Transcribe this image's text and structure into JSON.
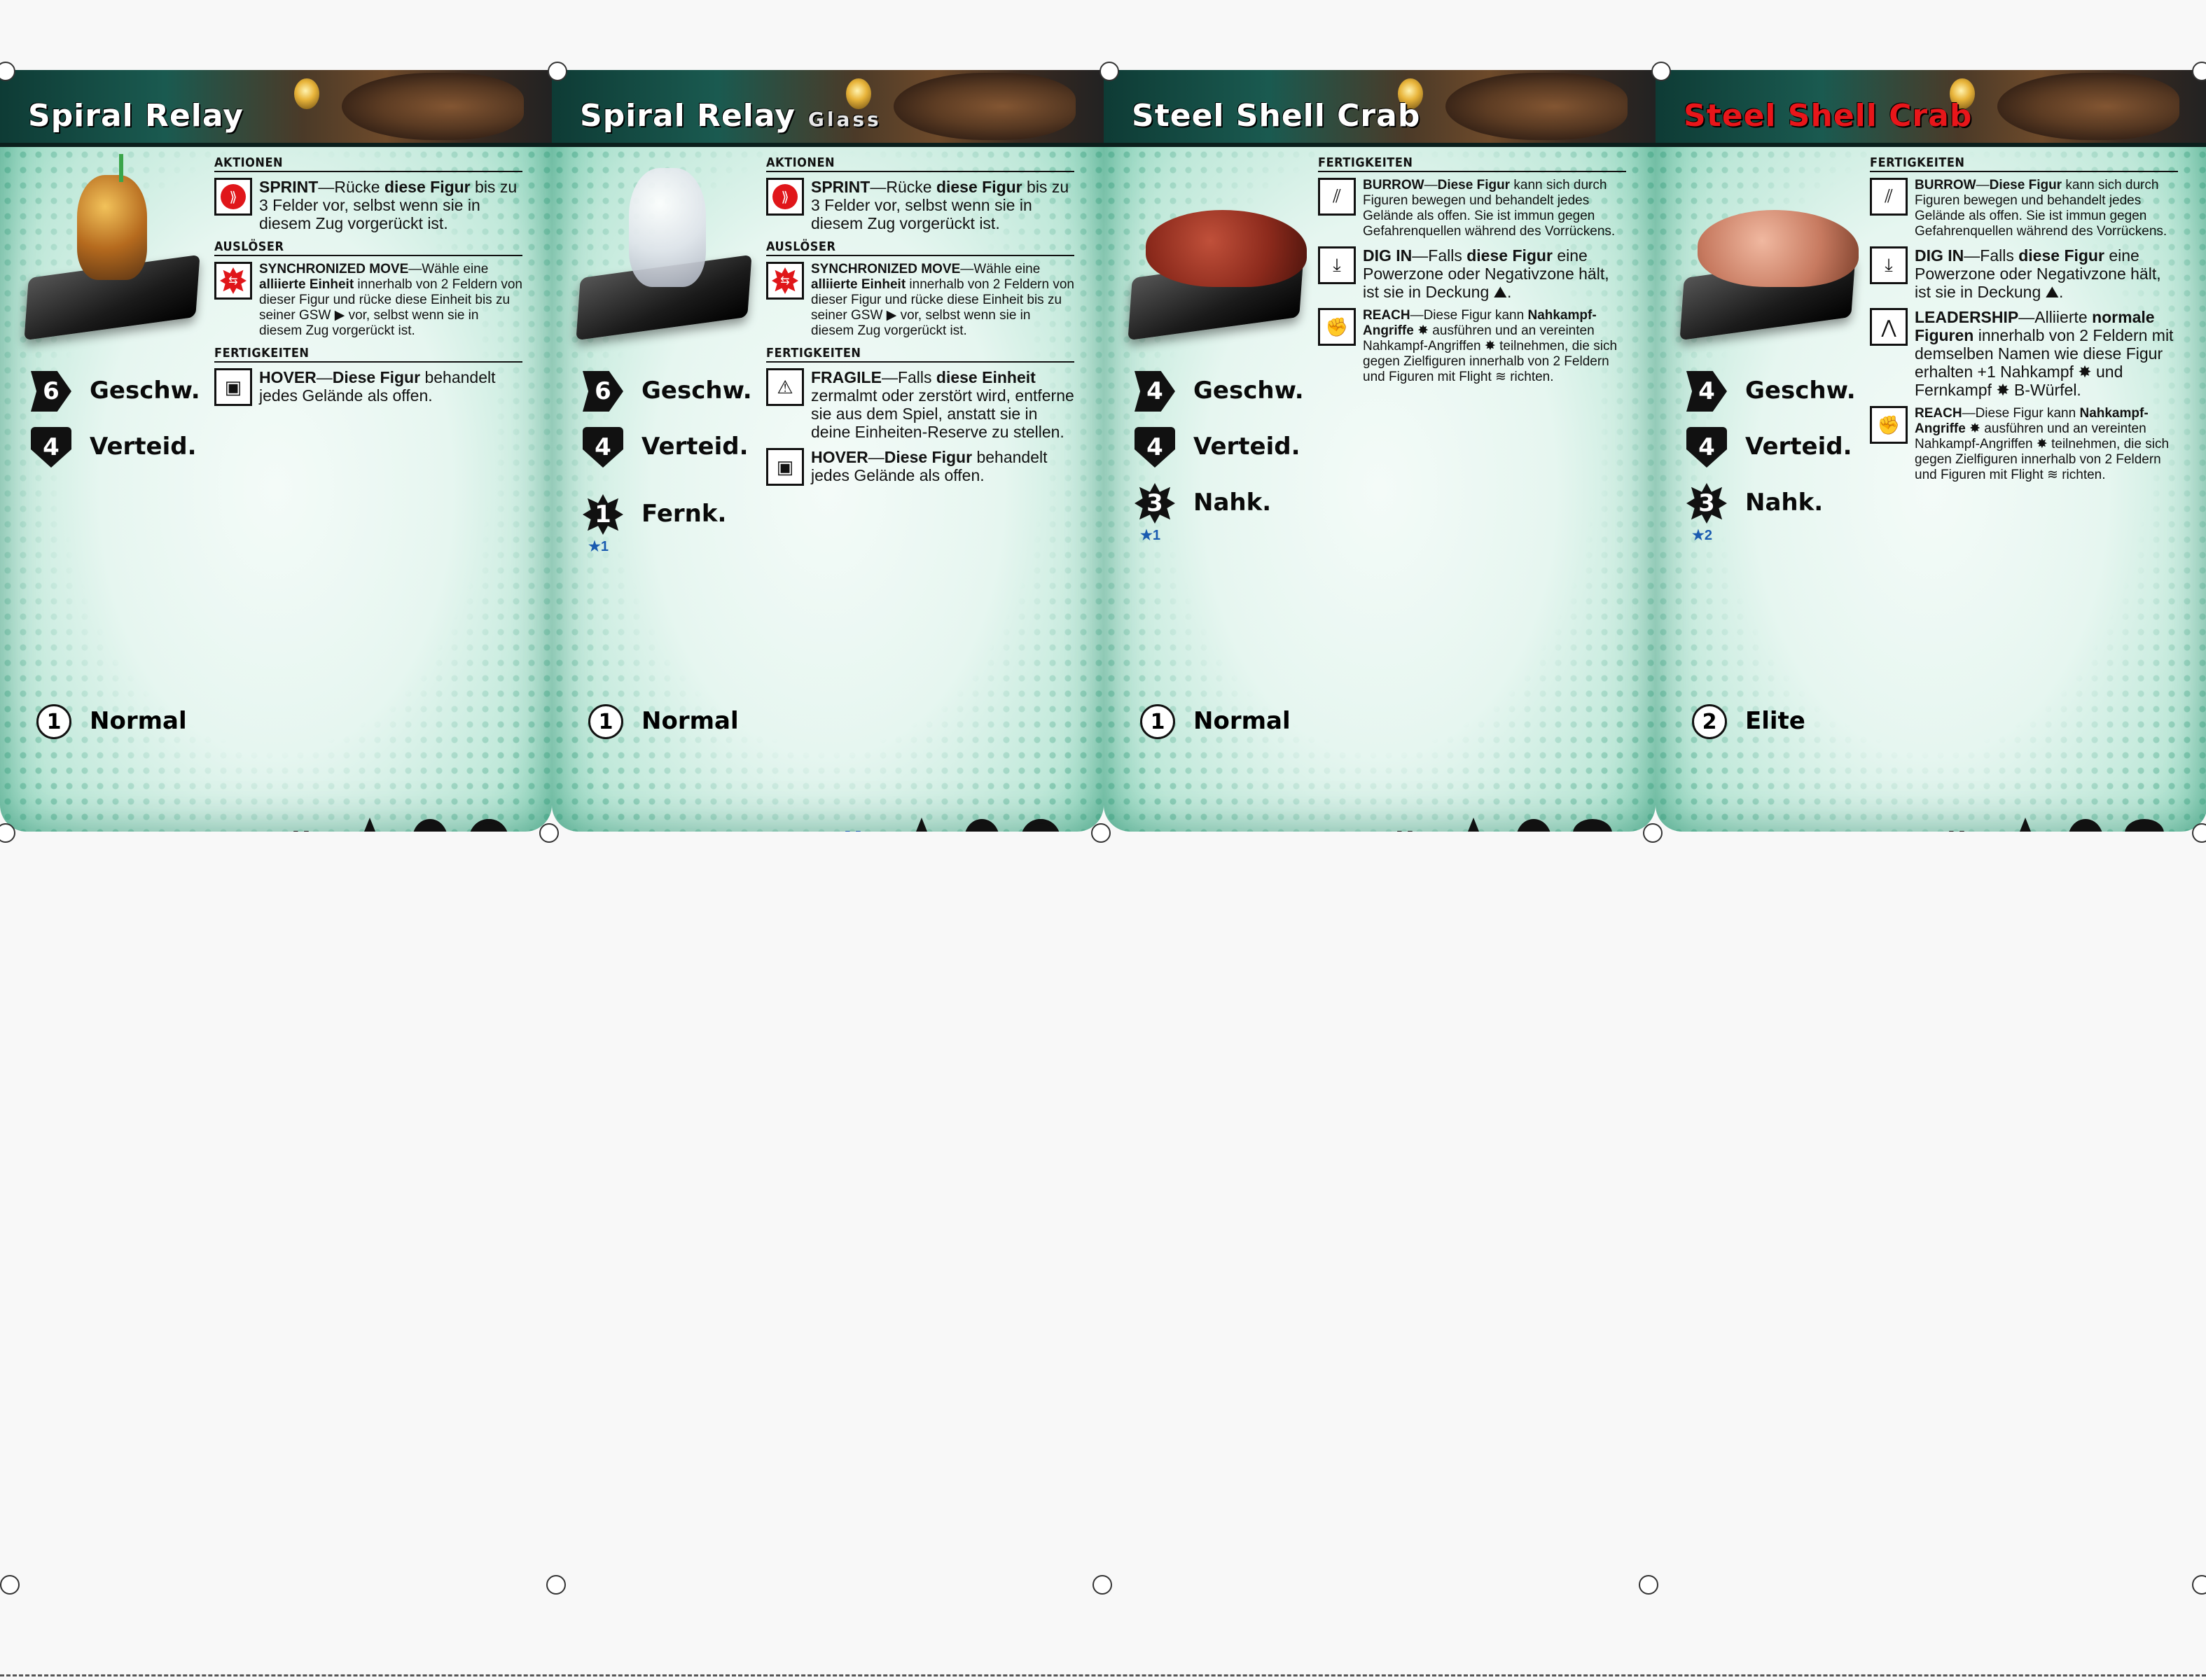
{
  "cards": [
    {
      "name": "Spiral Relay",
      "subtitle": "",
      "title_color": "#ffffff",
      "figure": "gold",
      "sections": [
        {
          "header": "AKTIONEN",
          "abilities": [
            {
              "icon": "sprint-icon",
              "style": "red",
              "text_html": "<b>SPRINT</b>—Rücke <b>diese Figur</b> bis zu 3 Felder vor, selbst wenn sie in diesem Zug vorgerückt ist.",
              "small": false
            }
          ]
        },
        {
          "header": "AUSLÖSER",
          "abilities": [
            {
              "icon": "synchronized-move-icon",
              "style": "redburst",
              "text_html": "<b>SYNCHRONIZED MOVE</b>—Wähle eine <b>alliierte Einheit</b> innerhalb von 2 Feldern von dieser Figur und rücke diese Einheit bis zu seiner GSW ▶ vor, selbst wenn sie in diesem Zug vorgerückt ist.",
              "small": true
            }
          ]
        },
        {
          "header": "FERTIGKEITEN",
          "abilities": [
            {
              "icon": "hover-icon",
              "style": "black",
              "text_html": "<b>HOVER</b>—<b>Diese Figur</b> behandelt jedes Gelände als offen.",
              "small": false
            }
          ]
        }
      ],
      "stats": [
        {
          "shape": "arrow",
          "value": "6",
          "label": "Geschw.",
          "bonus": ""
        },
        {
          "shape": "shield",
          "value": "4",
          "label": "Verteid.",
          "bonus": ""
        }
      ],
      "rank": {
        "value": "1",
        "label": "Normal"
      },
      "footer": {
        "stars": "★★",
        "now_color": "black",
        "last_icon": "gear"
      }
    },
    {
      "name": "Spiral Relay",
      "subtitle": "Glass",
      "title_color": "#ffffff",
      "figure": "glass",
      "sections": [
        {
          "header": "AKTIONEN",
          "abilities": [
            {
              "icon": "sprint-icon",
              "style": "red",
              "text_html": "<b>SPRINT</b>—Rücke <b>diese Figur</b> bis zu 3 Felder vor, selbst wenn sie in diesem Zug vorgerückt ist.",
              "small": false
            }
          ]
        },
        {
          "header": "AUSLÖSER",
          "abilities": [
            {
              "icon": "synchronized-move-icon",
              "style": "redburst",
              "text_html": "<b>SYNCHRONIZED MOVE</b>—Wähle eine <b>alliierte Einheit</b> innerhalb von 2 Feldern von dieser Figur und rücke diese Einheit bis zu seiner GSW ▶ vor, selbst wenn sie in diesem Zug vorgerückt ist.",
              "small": true
            }
          ]
        },
        {
          "header": "FERTIGKEITEN",
          "abilities": [
            {
              "icon": "fragile-icon",
              "style": "black",
              "text_html": "<b>FRAGILE</b>—Falls <b>diese Einheit</b> zermalmt oder zerstört wird, entferne sie aus dem Spiel, anstatt sie in deine Einheiten-Reserve zu stellen.",
              "small": false
            },
            {
              "icon": "hover-icon",
              "style": "black",
              "text_html": "<b>HOVER</b>—<b>Diese Figur</b> behandelt jedes Gelände als offen.",
              "small": false
            }
          ]
        }
      ],
      "stats": [
        {
          "shape": "arrow",
          "value": "6",
          "label": "Geschw.",
          "bonus": ""
        },
        {
          "shape": "shield",
          "value": "4",
          "label": "Verteid.",
          "bonus": ""
        },
        {
          "shape": "burst",
          "value": "1",
          "label": "Fernk.",
          "bonus": "★1",
          "gap": true
        }
      ],
      "rank": {
        "value": "1",
        "label": "Normal"
      },
      "footer": {
        "stars": "★★★★",
        "now_color": "blue",
        "last_icon": "gear"
      }
    },
    {
      "name": "Steel Shell Crab",
      "subtitle": "",
      "title_color": "#ffffff",
      "figure": "crab",
      "sections": [
        {
          "header": "FERTIGKEITEN",
          "abilities": [
            {
              "icon": "burrow-icon",
              "style": "black",
              "text_html": "<b>BURROW</b>—<b>Diese Figur</b> kann sich durch Figuren bewegen und behandelt jedes Gelände als offen. Sie ist immun gegen Gefahrenquellen während des Vorrückens.",
              "small": true
            },
            {
              "icon": "dig-in-icon",
              "style": "black",
              "text_html": "<b>DIG IN</b>—Falls <b>diese Figur</b> eine Powerzone oder Negativzone hält, ist sie in Deckung ⛰.",
              "small": false
            },
            {
              "icon": "reach-icon",
              "style": "black",
              "text_html": "<b>REACH</b>—Diese Figur kann <b>Nahkampf-Angriffe</b> ✸ ausführen und an vereinten Nahkampf-Angriffen ✸ teilnehmen, die sich gegen Zielfiguren innerhalb von 2 Feldern und Figuren mit Flight ≋ richten.",
              "small": true
            }
          ]
        }
      ],
      "stats": [
        {
          "shape": "arrow",
          "value": "4",
          "label": "Geschw.",
          "bonus": ""
        },
        {
          "shape": "shield",
          "value": "4",
          "label": "Verteid.",
          "bonus": ""
        },
        {
          "shape": "burst",
          "value": "3",
          "label": "Nahk.",
          "bonus": "★1"
        }
      ],
      "rank": {
        "value": "1",
        "label": "Normal"
      },
      "footer": {
        "stars": "★",
        "now_color": "black",
        "last_icon": "tree"
      }
    },
    {
      "name": "Steel Shell Crab",
      "subtitle": "",
      "title_color": "#e8161a",
      "figure": "crab-elite",
      "sections": [
        {
          "header": "FERTIGKEITEN",
          "abilities": [
            {
              "icon": "burrow-icon",
              "style": "black",
              "text_html": "<b>BURROW</b>—<b>Diese Figur</b> kann sich durch Figuren bewegen und behandelt jedes Gelände als offen. Sie ist immun gegen Gefahrenquellen während des Vorrückens.",
              "small": true
            },
            {
              "icon": "dig-in-icon",
              "style": "black",
              "text_html": "<b>DIG IN</b>—Falls <b>diese Figur</b> eine Powerzone oder Negativzone hält, ist sie in Deckung ⛰.",
              "small": false
            },
            {
              "icon": "leadership-icon",
              "style": "black",
              "text_html": "<b>LEADERSHIP</b>—Alliierte <b>normale Figuren</b> innerhalb von 2 Feldern mit demselben Namen wie diese Figur erhalten +1 Nahkampf ✸ und Fernkampf ✸ B-Würfel.",
              "small": false
            },
            {
              "icon": "reach-icon",
              "style": "black",
              "text_html": "<b>REACH</b>—Diese Figur kann <b>Nahkampf-Angriffe</b> ✸ ausführen und an vereinten Nahkampf-Angriffen ✸ teilnehmen, die sich gegen Zielfiguren innerhalb von 2 Feldern und Figuren mit Flight ≋ richten.",
              "small": true
            }
          ]
        }
      ],
      "stats": [
        {
          "shape": "arrow",
          "value": "4",
          "label": "Geschw.",
          "bonus": ""
        },
        {
          "shape": "shield",
          "value": "4",
          "label": "Verteid.",
          "bonus": ""
        },
        {
          "shape": "burst",
          "value": "3",
          "label": "Nahk.",
          "bonus": "★2"
        }
      ],
      "rank": {
        "value": "2",
        "label": "Elite"
      },
      "footer": {
        "stars": "★★★",
        "now_color": "black",
        "last_icon": "tree"
      }
    }
  ],
  "footer_now_label": "Now",
  "colors": {
    "card_green": "#79cdb0",
    "stat_black": "#111111",
    "bonus_blue": "#1a5bb0",
    "elite_red": "#e8161a"
  }
}
